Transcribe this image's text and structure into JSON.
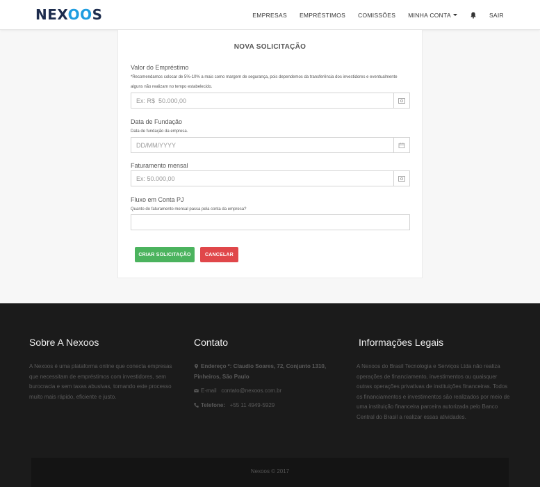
{
  "header": {
    "logo": {
      "prefix": "NEX",
      "accent": "OO",
      "suffix": "S"
    },
    "nav": {
      "empresas": "EMPRESAS",
      "emprestimos": "EMPRÉSTIMOS",
      "comissoes": "COMISSÕES",
      "minha_conta": "MINHA CONTA",
      "sair": "SAIR"
    }
  },
  "form": {
    "title": "NOVA SOLICITAÇÃO",
    "valor": {
      "label": "Valor do Empréstimo",
      "help": "*Recomendamos colocar de 5%-10% a mais como margem de segurança, pois dependemos da transferência dos investidores e eventualmente alguns não realizam no tempo estabelecido.",
      "placeholder": "Ex: R$  50.000,00",
      "value": ""
    },
    "fundacao": {
      "label": "Data de Fundação",
      "help": "Data de fundação da empresa.",
      "placeholder": "DD/MM/YYYY",
      "value": ""
    },
    "faturamento": {
      "label": "Faturamento mensal",
      "placeholder": "Ex: 50.000,00",
      "value": ""
    },
    "fluxo": {
      "label": "Fluxo em Conta PJ",
      "help": "Quanto do faturamento mensal passa pela conta da empresa?",
      "placeholder": "",
      "value": ""
    },
    "submit_label": "CRIAR SOLICITAÇÃO",
    "cancel_label": "CANCELAR"
  },
  "footer": {
    "about": {
      "title": "Sobre A Nexoos",
      "text": "A Nexoos é uma plataforma online que conecta empresas que necessitam de empréstimos com investidores, sem burocracia e sem taxas abusivas, tornando este processo muito mais rápido, eficiente e justo."
    },
    "contact": {
      "title": "Contato",
      "address_label": "Endereço *:",
      "address_value": "Claudio Soares, 72, Conjunto 1310, Pinheiros, São Paulo",
      "email_label": "E-mail",
      "email_value": "contato@nexoos.com.br",
      "phone_label": "Telefone:",
      "phone_value": "+55 11 4949-5929"
    },
    "legal": {
      "title": "Informações Legais",
      "text": "A Nexoos do Brasil Tecnologia e Serviços Ltda não realiza operações de financiamento, investimentos ou quaisquer outras operações privativas de instituições financeiras. Todos os financiamentos e investimentos são realizados por meio de uma instituição financeira parceira autorizada pelo Banco Central do Brasil a realizar essas atividades."
    },
    "copyright": "Nexoos © 2017"
  },
  "colors": {
    "brand_dark": "#1d2c4d",
    "brand_accent": "#1f9de0",
    "success": "#4bb35e",
    "danger": "#e0474a",
    "footer_bg": "#1b1b1b"
  },
  "icons": {
    "money": "money-icon",
    "calendar": "calendar-icon",
    "bell": "bell-icon",
    "map_marker": "map-marker-icon",
    "envelope": "envelope-icon",
    "phone": "phone-icon"
  }
}
